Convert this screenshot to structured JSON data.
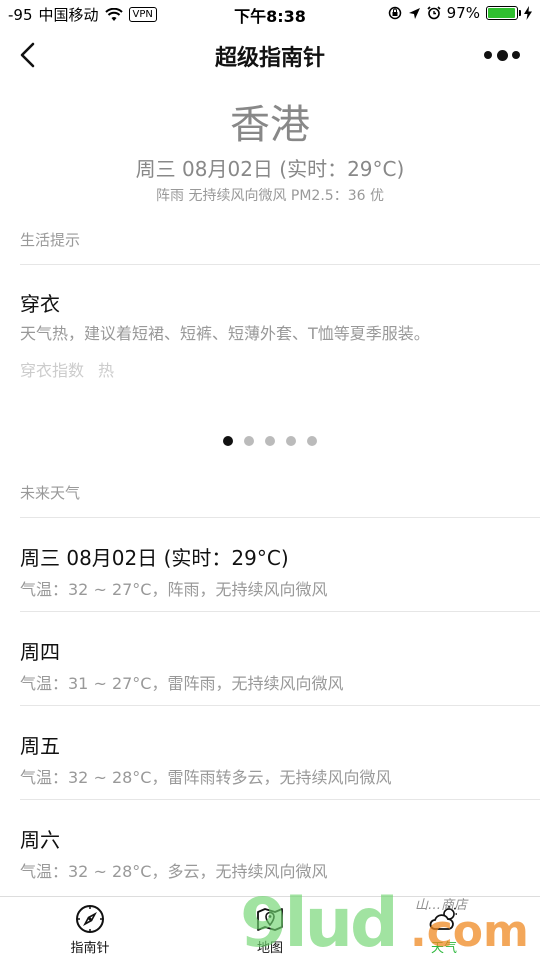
{
  "status_bar": {
    "signal": "-95",
    "carrier": "中国移动",
    "vpn": "VPN",
    "time": "下午8:38",
    "battery": "97%",
    "battery_level": 0.97
  },
  "nav": {
    "title": "超级指南针"
  },
  "header": {
    "city": "香港",
    "date_line": "周三 08月02日 (实时：29°C)",
    "condition_line": "阵雨 无持续风向微风 PM2.5：36 优"
  },
  "life_tips": {
    "section_label": "生活提示",
    "title": "穿衣",
    "description": "天气热，建议着短裙、短裤、短薄外套、T恤等夏季服装。",
    "index_label": "穿衣指数",
    "index_value": "热",
    "pager_count": 5,
    "pager_active": 0
  },
  "forecast": {
    "section_label": "未来天气",
    "items": [
      {
        "day": "周三 08月02日 (实时：29°C)",
        "desc": "气温：32 ~ 27°C，阵雨，无持续风向微风"
      },
      {
        "day": "周四",
        "desc": "气温：31 ~ 27°C，雷阵雨，无持续风向微风"
      },
      {
        "day": "周五",
        "desc": "气温：32 ~ 28°C，雷阵雨转多云，无持续风向微风"
      },
      {
        "day": "周六",
        "desc": "气温：32 ~ 28°C，多云，无持续风向微风"
      }
    ]
  },
  "tab_bar": {
    "tabs": [
      {
        "label": "指南针",
        "icon": "compass-icon"
      },
      {
        "label": "地图",
        "icon": "map-icon"
      },
      {
        "label": "天气",
        "icon": "weather-icon"
      }
    ],
    "active_color": "#2db83d"
  },
  "watermark": {
    "big": "9lud",
    "com": ".com",
    "small": "山…商店"
  }
}
